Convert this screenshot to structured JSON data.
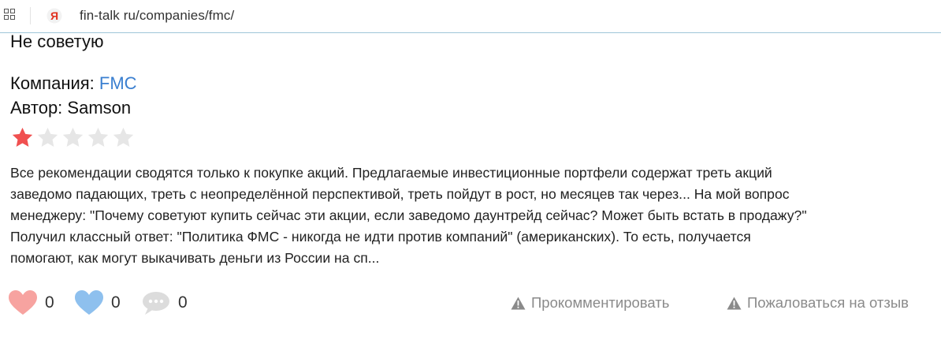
{
  "browser": {
    "url": "fin-talk ru/companies/fmc/",
    "grid_icon": "tabs-grid-icon",
    "site_icon": "yandex-icon",
    "site_icon_letter": "Я"
  },
  "review": {
    "title": "Не советую",
    "company_label": "Компания:",
    "company_name": "FMC",
    "author_label": "Автор:",
    "author_name": "Samson",
    "rating": 1,
    "rating_max": 5,
    "text_lines": [
      "Все рекомендации сводятся только к покупке акций. Предлагаемые инвестиционные портфели содержат треть акций",
      "заведомо падающих, треть с неопределённой перспективой, треть пойдут в рост, но месяцев так через... На мой вопрос",
      "менеджеру: \"Почему советуют купить сейчас эти акции, если заведомо даунтрейд сейчас? Может быть встать в продажу?\"",
      "Получил классный ответ: \"Политика ФМС - никогда не идти против компаний\" (американских). То есть, получается",
      "помогают, как могут выкачивать деньги из России на сп..."
    ]
  },
  "actions": {
    "like_count": "0",
    "like_blue_count": "0",
    "comment_count": "0",
    "comment_link": "Прокомментировать",
    "report_link": "Пожаловаться на отзыв"
  },
  "colors": {
    "link": "#3a7fd0",
    "star_active": "#f05050",
    "star_inactive": "#e6e6e6",
    "heart_pink": "#f7a3a0",
    "heart_blue": "#8ec0ee",
    "bubble_gray": "#dcdcdc",
    "muted": "#8a8a8a"
  }
}
